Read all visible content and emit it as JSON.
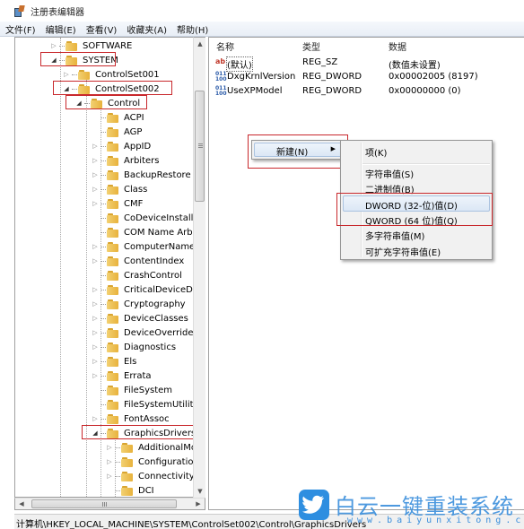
{
  "window": {
    "title": "注册表编辑器",
    "icon": "regedit-icon"
  },
  "menubar": [
    "文件(F)",
    "编辑(E)",
    "查看(V)",
    "收藏夹(A)",
    "帮助(H)"
  ],
  "tree": {
    "nodes": [
      {
        "label": "SOFTWARE",
        "level": 0,
        "expander": "collapsed",
        "highlighted": false
      },
      {
        "label": "SYSTEM",
        "level": 0,
        "expander": "expanded",
        "highlighted": true
      },
      {
        "label": "ControlSet001",
        "level": 1,
        "expander": "collapsed",
        "highlighted": false
      },
      {
        "label": "ControlSet002",
        "level": 1,
        "expander": "expanded",
        "highlighted": true
      },
      {
        "label": "Control",
        "level": 2,
        "expander": "expanded",
        "highlighted": true
      },
      {
        "label": "ACPI",
        "level": 3,
        "expander": "none",
        "highlighted": false
      },
      {
        "label": "AGP",
        "level": 3,
        "expander": "none",
        "highlighted": false
      },
      {
        "label": "AppID",
        "level": 3,
        "expander": "collapsed",
        "highlighted": false
      },
      {
        "label": "Arbiters",
        "level": 3,
        "expander": "collapsed",
        "highlighted": false
      },
      {
        "label": "BackupRestore",
        "level": 3,
        "expander": "collapsed",
        "highlighted": false
      },
      {
        "label": "Class",
        "level": 3,
        "expander": "collapsed",
        "highlighted": false
      },
      {
        "label": "CMF",
        "level": 3,
        "expander": "collapsed",
        "highlighted": false
      },
      {
        "label": "CoDeviceInstallers",
        "level": 3,
        "expander": "none",
        "highlighted": false
      },
      {
        "label": "COM Name Arbite",
        "level": 3,
        "expander": "none",
        "highlighted": false
      },
      {
        "label": "ComputerName",
        "level": 3,
        "expander": "collapsed",
        "highlighted": false
      },
      {
        "label": "ContentIndex",
        "level": 3,
        "expander": "collapsed",
        "highlighted": false
      },
      {
        "label": "CrashControl",
        "level": 3,
        "expander": "none",
        "highlighted": false
      },
      {
        "label": "CriticalDeviceDatab",
        "level": 3,
        "expander": "collapsed",
        "highlighted": false
      },
      {
        "label": "Cryptography",
        "level": 3,
        "expander": "collapsed",
        "highlighted": false
      },
      {
        "label": "DeviceClasses",
        "level": 3,
        "expander": "collapsed",
        "highlighted": false
      },
      {
        "label": "DeviceOverrides",
        "level": 3,
        "expander": "collapsed",
        "highlighted": false
      },
      {
        "label": "Diagnostics",
        "level": 3,
        "expander": "collapsed",
        "highlighted": false
      },
      {
        "label": "Els",
        "level": 3,
        "expander": "collapsed",
        "highlighted": false
      },
      {
        "label": "Errata",
        "level": 3,
        "expander": "collapsed",
        "highlighted": false
      },
      {
        "label": "FileSystem",
        "level": 3,
        "expander": "none",
        "highlighted": false
      },
      {
        "label": "FileSystemUtilities",
        "level": 3,
        "expander": "none",
        "highlighted": false
      },
      {
        "label": "FontAssoc",
        "level": 3,
        "expander": "collapsed",
        "highlighted": false
      },
      {
        "label": "GraphicsDrivers",
        "level": 3,
        "expander": "expanded",
        "highlighted": true
      },
      {
        "label": "AdditionalMode",
        "level": 4,
        "expander": "collapsed",
        "highlighted": false
      },
      {
        "label": "Configuration",
        "level": 4,
        "expander": "collapsed",
        "highlighted": false
      },
      {
        "label": "Connectivity",
        "level": 4,
        "expander": "collapsed",
        "highlighted": false
      },
      {
        "label": "DCI",
        "level": 4,
        "expander": "none",
        "highlighted": false
      }
    ]
  },
  "values": {
    "columns": [
      "名称",
      "类型",
      "数据"
    ],
    "rows": [
      {
        "icon": "string-value-icon",
        "name": "(默认)",
        "type": "REG_SZ",
        "data": "(数值未设置)"
      },
      {
        "icon": "binary-value-icon",
        "name": "DxgKrnlVersion",
        "type": "REG_DWORD",
        "data": "0x00002005 (8197)"
      },
      {
        "icon": "binary-value-icon",
        "name": "UseXPModel",
        "type": "REG_DWORD",
        "data": "0x00000000 (0)"
      }
    ]
  },
  "context_menu": {
    "new_label": "新建(N)",
    "submenu": [
      {
        "label": "项(K)"
      },
      {
        "label": "字符串值(S)"
      },
      {
        "label": "二进制值(B)"
      },
      {
        "label": "DWORD (32-位)值(D)"
      },
      {
        "label": "QWORD (64 位)值(Q)"
      },
      {
        "label": "多字符串值(M)"
      },
      {
        "label": "可扩充字符串值(E)"
      }
    ]
  },
  "statusbar": {
    "path": "计算机\\HKEY_LOCAL_MACHINE\\SYSTEM\\ControlSet002\\Control\\GraphicsDrivers"
  },
  "watermark": {
    "brand": "白云一键重装系统",
    "url": "www.baiyunxitong.com",
    "color": "#3a8fdc"
  },
  "highlight_color": "#c8282c"
}
